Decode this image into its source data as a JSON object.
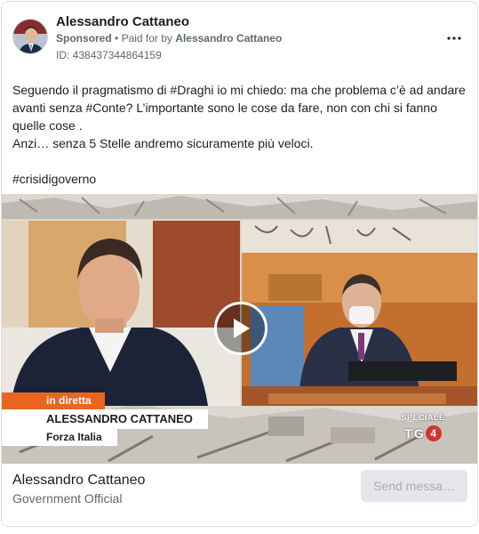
{
  "ad": {
    "advertiser_name": "Alessandro Cattaneo",
    "sponsored_label": "Sponsored",
    "separator": "•",
    "paid_for_label": "Paid for by",
    "paid_for_name": "Alessandro Cattaneo",
    "id_line": "ID: 438437344864159",
    "body_lines": [
      "Seguendo il pragmatismo di #Draghi io mi chiedo: ma che problema c’è ad andare avanti senza #Conte? L’importante sono le cose da fare, non con chi si fanno quelle cose .",
      "Anzi… senza 5 Stelle andremo sicuramente più veloci."
    ],
    "hashtag_line": "#crisidigoverno"
  },
  "video": {
    "live_label": "in diretta",
    "name_label": "ALESSANDRO CATTANEO",
    "party_label": "Forza Italia",
    "logo_top": "SPECIALE",
    "logo_bottom_letters": [
      "T",
      "G",
      "4"
    ]
  },
  "footer": {
    "page_name": "Alessandro Cattaneo",
    "page_category": "Government Official",
    "cta_label": "Send messa…"
  },
  "icons": {
    "more": "more-horizontal-icon",
    "play": "play-icon"
  },
  "colors": {
    "banner_orange": "#e8661f",
    "tg4_red": "#d9322b",
    "muted_text": "#606770",
    "cta_bg": "#e4e6eb"
  }
}
